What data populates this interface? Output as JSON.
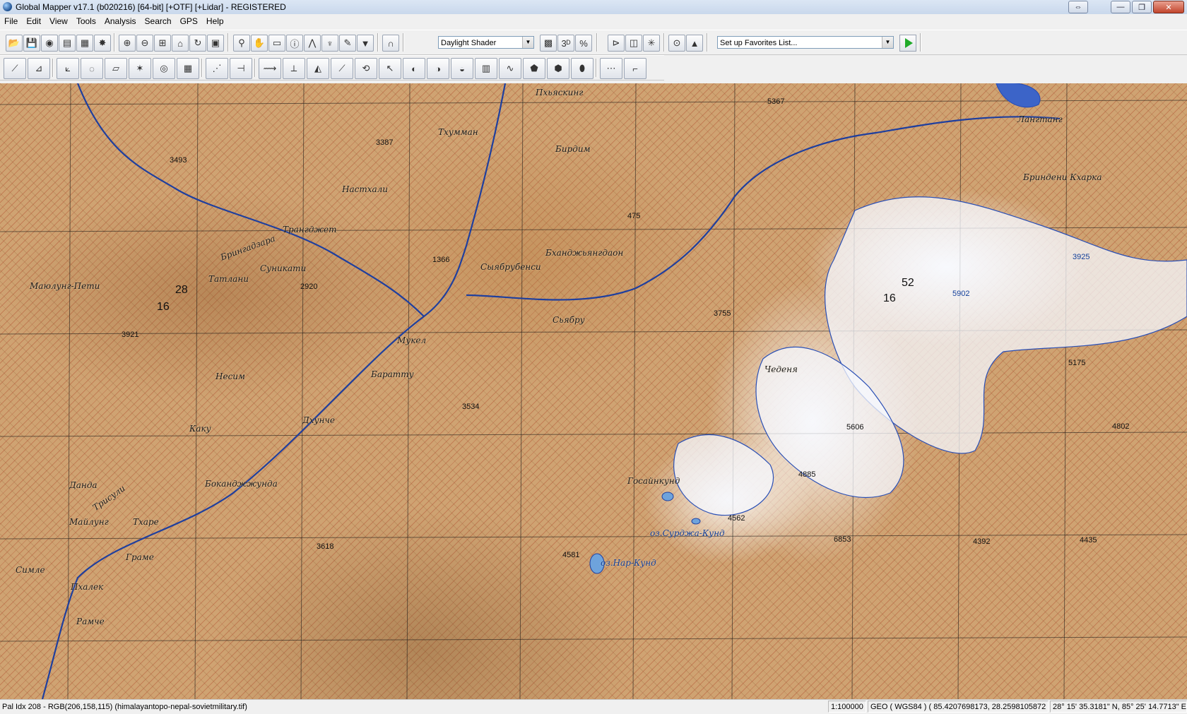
{
  "window": {
    "title": "Global Mapper v17.1 (b020216) [64-bit] [+OTF] [+Lidar] - REGISTERED",
    "buttons": [
      "⇔",
      "—",
      "❐",
      "✕"
    ]
  },
  "menu": [
    "File",
    "Edit",
    "View",
    "Tools",
    "Analysis",
    "Search",
    "GPS",
    "Help"
  ],
  "toolbar": {
    "shader": "Daylight Shader",
    "favorites": "Set up Favorites List..."
  },
  "map": {
    "labels": [
      {
        "text": "Пхьяскинг",
        "blue": false
      },
      {
        "text": "Тхумман",
        "blue": false
      },
      {
        "text": "Настхали",
        "blue": false
      },
      {
        "text": "Брингадзара",
        "blue": false
      },
      {
        "text": "Трангджет",
        "blue": false
      },
      {
        "text": "Маюлунг-Пети",
        "blue": false
      },
      {
        "text": "Татлани",
        "blue": false
      },
      {
        "text": "Суникати",
        "blue": false
      },
      {
        "text": "Сыябрубенси",
        "blue": false
      },
      {
        "text": "Бханджьянгдаон",
        "blue": false
      },
      {
        "text": "Сьябру",
        "blue": false
      },
      {
        "text": "Несим",
        "blue": false
      },
      {
        "text": "Баратту",
        "blue": false
      },
      {
        "text": "Мукел",
        "blue": false
      },
      {
        "text": "Дхунче",
        "blue": false
      },
      {
        "text": "Каку",
        "blue": false
      },
      {
        "text": "Данда",
        "blue": false
      },
      {
        "text": "Боканджжунда",
        "blue": false
      },
      {
        "text": "Майлунг",
        "blue": false
      },
      {
        "text": "Тхаре",
        "blue": false
      },
      {
        "text": "Граме",
        "blue": false
      },
      {
        "text": "Симле",
        "blue": false
      },
      {
        "text": "Пхалек",
        "blue": false
      },
      {
        "text": "Рамче",
        "blue": false
      },
      {
        "text": "Госайнкунд",
        "blue": false
      },
      {
        "text": "оз.Сурджа-Кунд",
        "blue": true
      },
      {
        "text": "оз.Нар-Кунд",
        "blue": true
      },
      {
        "text": "Трисули",
        "blue": false
      },
      {
        "text": "Лангтанг",
        "blue": false
      },
      {
        "text": "Бриндени Кхарка",
        "blue": false
      },
      {
        "text": "Чеденя",
        "blue": false
      },
      {
        "text": "Бирдим",
        "blue": false
      }
    ],
    "numbers": [
      "3387",
      "3493",
      "1366",
      "2920",
      "3921",
      "3534",
      "3755",
      "3618",
      "4581",
      "4562",
      "4885",
      "5606",
      "6853",
      "4392",
      "4435",
      "4802",
      "5175",
      "5902",
      "3925",
      "5367",
      "475",
      "16",
      "28",
      "52",
      "16"
    ]
  },
  "status": {
    "left": "Pal Idx 208 - RGB(206,158,115) (himalayantopo-nepal-sovietmilitary.tif)",
    "scale": "1:100000",
    "geo": "GEO ( WGS84 ) ( 85.4207698173, 28.2598105872 )",
    "coords": "28° 15' 35.3181\" N, 85° 25' 14.7713\" E"
  }
}
